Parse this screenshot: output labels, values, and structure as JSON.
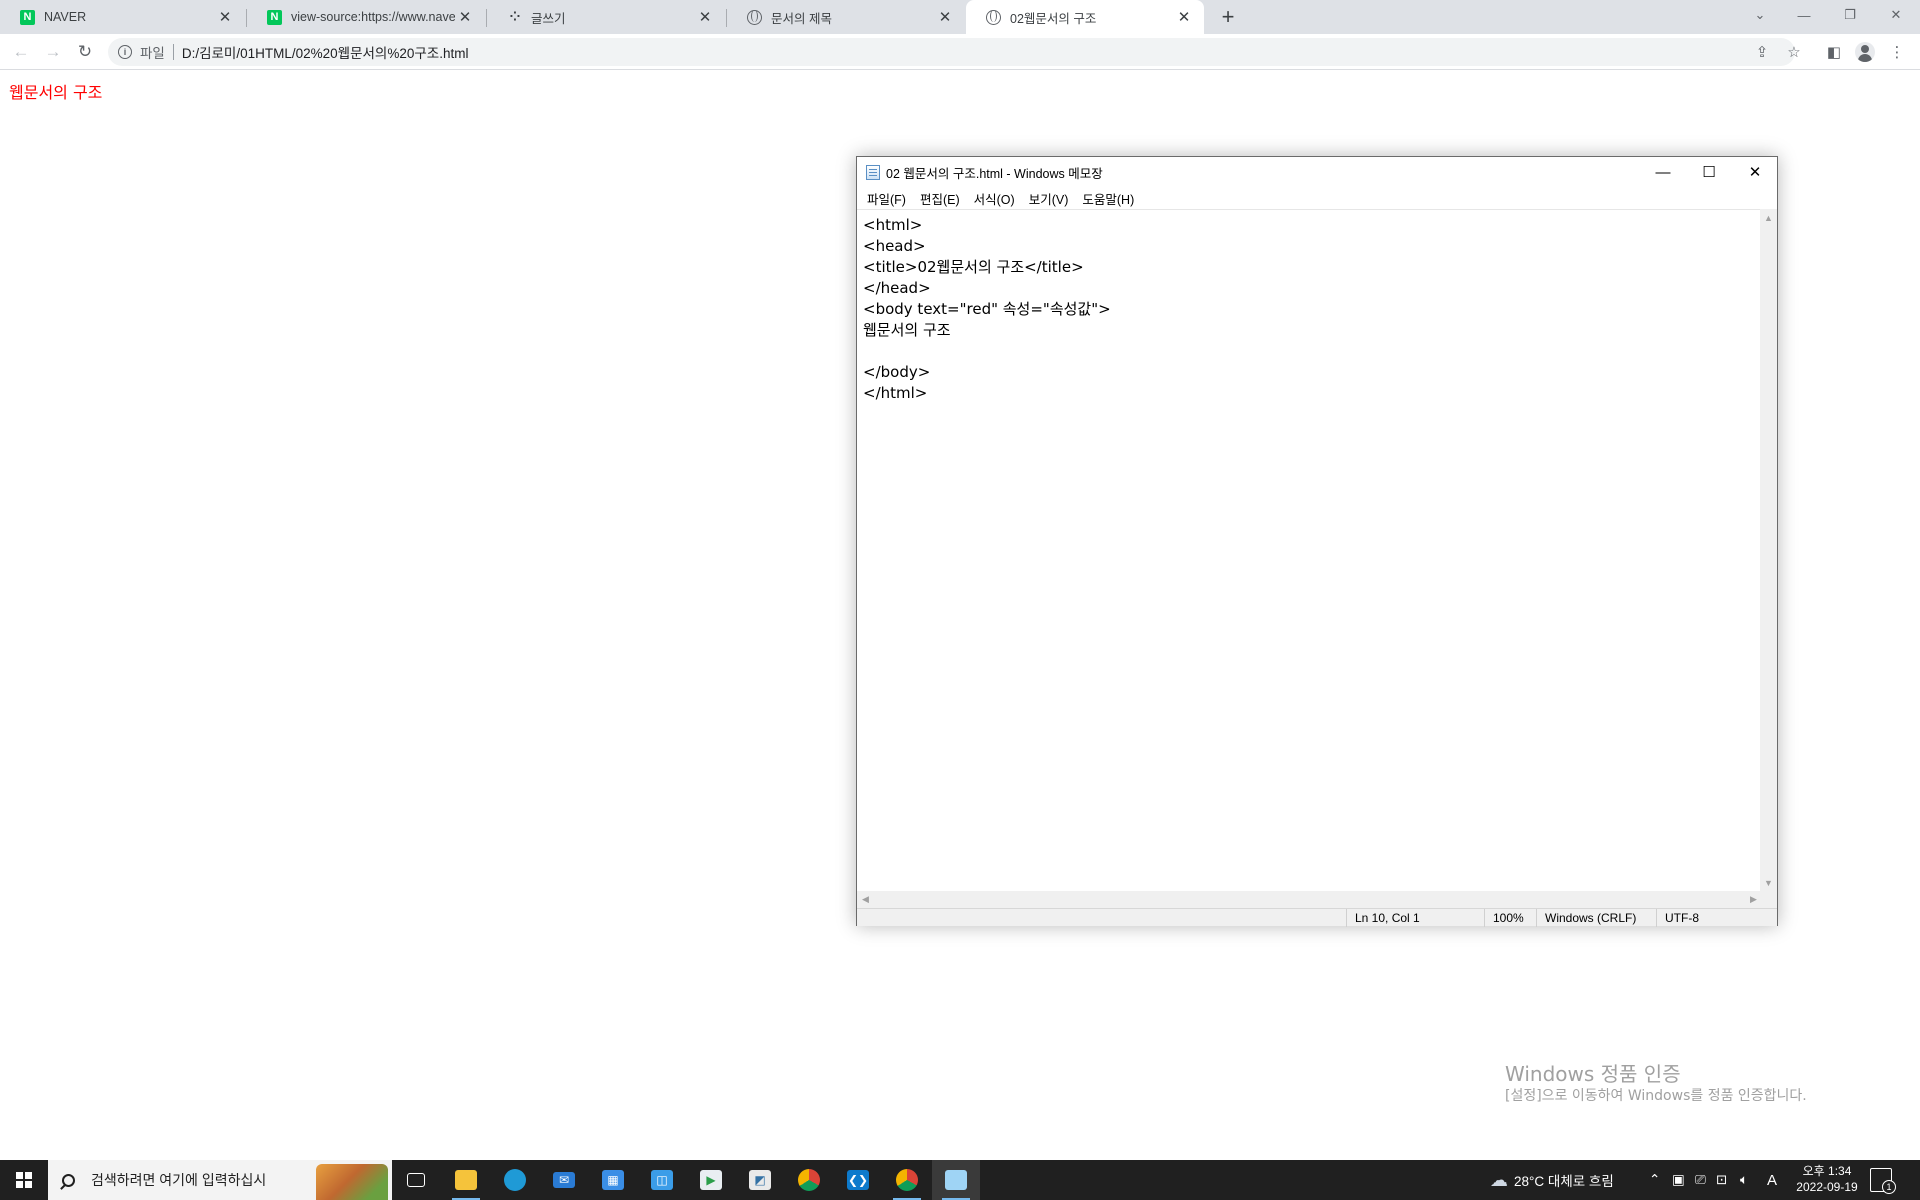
{
  "browser": {
    "tabs": [
      {
        "title": "NAVER",
        "icon": "naver-icon",
        "active": false
      },
      {
        "title": "view-source:https://www.naver.c",
        "icon": "naver-icon",
        "active": false
      },
      {
        "title": "글쓰기",
        "icon": "dots-icon",
        "active": false
      },
      {
        "title": "문서의 제목",
        "icon": "globe-icon",
        "active": false
      },
      {
        "title": "02웹문서의 구조",
        "icon": "globe-icon",
        "active": true
      }
    ],
    "address": {
      "scheme_label": "파일",
      "url": "D:/김로미/01HTML/02%20웹문서의%20구조.html"
    }
  },
  "page": {
    "body_text": "웹문서의 구조",
    "text_color": "#ff0000"
  },
  "notepad": {
    "title": "02 웹문서의 구조.html - Windows 메모장",
    "menu": [
      "파일(F)",
      "편집(E)",
      "서식(O)",
      "보기(V)",
      "도움말(H)"
    ],
    "content": "<html>\n<head>\n<title>02웹문서의 구조</title>\n</head>\n<body text=\"red\" 속성=\"속성값\">\n웹문서의 구조\n\n</body>\n</html>",
    "status": {
      "position": "Ln 10, Col 1",
      "zoom": "100%",
      "line_ending": "Windows (CRLF)",
      "encoding": "UTF-8"
    }
  },
  "watermark": {
    "title": "Windows 정품 인증",
    "subtitle": "[설정]으로 이동하여 Windows를 정품 인증합니다."
  },
  "taskbar": {
    "search_placeholder": "검색하려면 여기에 입력하십시",
    "weather": "28°C  대체로 흐림",
    "ime": "A",
    "time": "오후 1:34",
    "date": "2022-09-19",
    "notification_count": "1"
  }
}
